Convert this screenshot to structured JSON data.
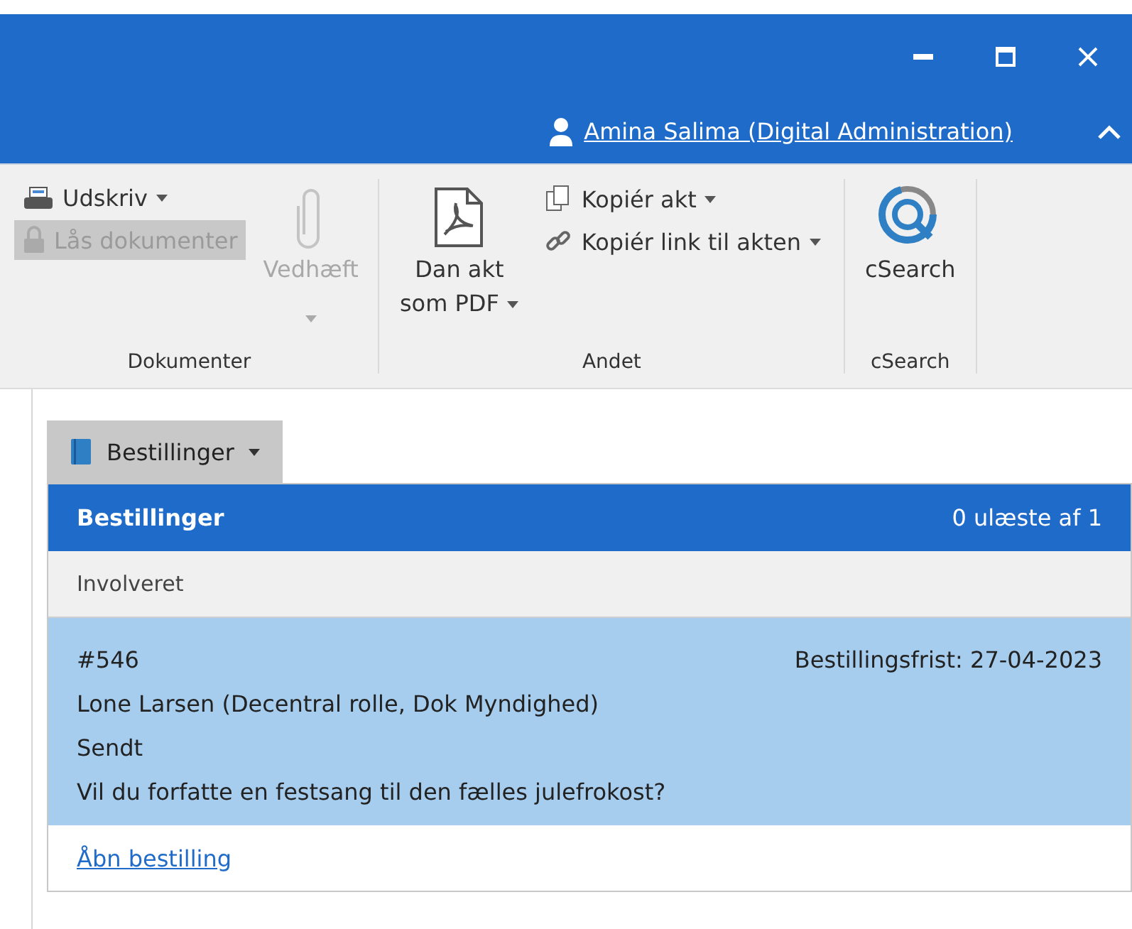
{
  "user": {
    "name": "Amina Salima (Digital Administration)"
  },
  "ribbon": {
    "groups": [
      {
        "label": "Dokumenter",
        "items": [
          {
            "kind": "stack",
            "buttons": [
              {
                "label": "Udskriv",
                "dropdown": true,
                "disabled": false,
                "hovered": false
              },
              {
                "label": "Lås dokumenter",
                "dropdown": false,
                "disabled": true,
                "hovered": true
              }
            ]
          },
          {
            "kind": "large",
            "lines": [
              "Vedhæft"
            ],
            "dropdown": true,
            "disabled": true
          }
        ]
      },
      {
        "label": "Andet",
        "items": [
          {
            "kind": "large",
            "lines": [
              "Dan akt",
              "som PDF"
            ],
            "dropdown": true,
            "disabled": false
          },
          {
            "kind": "stack",
            "buttons": [
              {
                "label": "Kopiér akt",
                "dropdown": true,
                "disabled": false,
                "hovered": false
              },
              {
                "label": "Kopiér link til akten",
                "dropdown": true,
                "disabled": false,
                "hovered": false
              }
            ]
          }
        ]
      },
      {
        "label": "cSearch",
        "items": [
          {
            "kind": "large",
            "lines": [
              "cSearch"
            ],
            "dropdown": false,
            "disabled": false
          }
        ]
      }
    ]
  },
  "tab": {
    "label": "Bestillinger"
  },
  "panel": {
    "title": "Bestillinger",
    "count": "0 ulæste af 1",
    "section": "Involveret",
    "orders": [
      {
        "number": "#546",
        "deadline": "Bestillingsfrist: 27-04-2023",
        "person": "Lone Larsen (Decentral rolle, Dok Myndighed)",
        "status": "Sendt",
        "subject": "Vil du forfatte en festsang til den fælles julefrokost?",
        "selected": true
      }
    ],
    "link": "Åbn bestilling"
  }
}
